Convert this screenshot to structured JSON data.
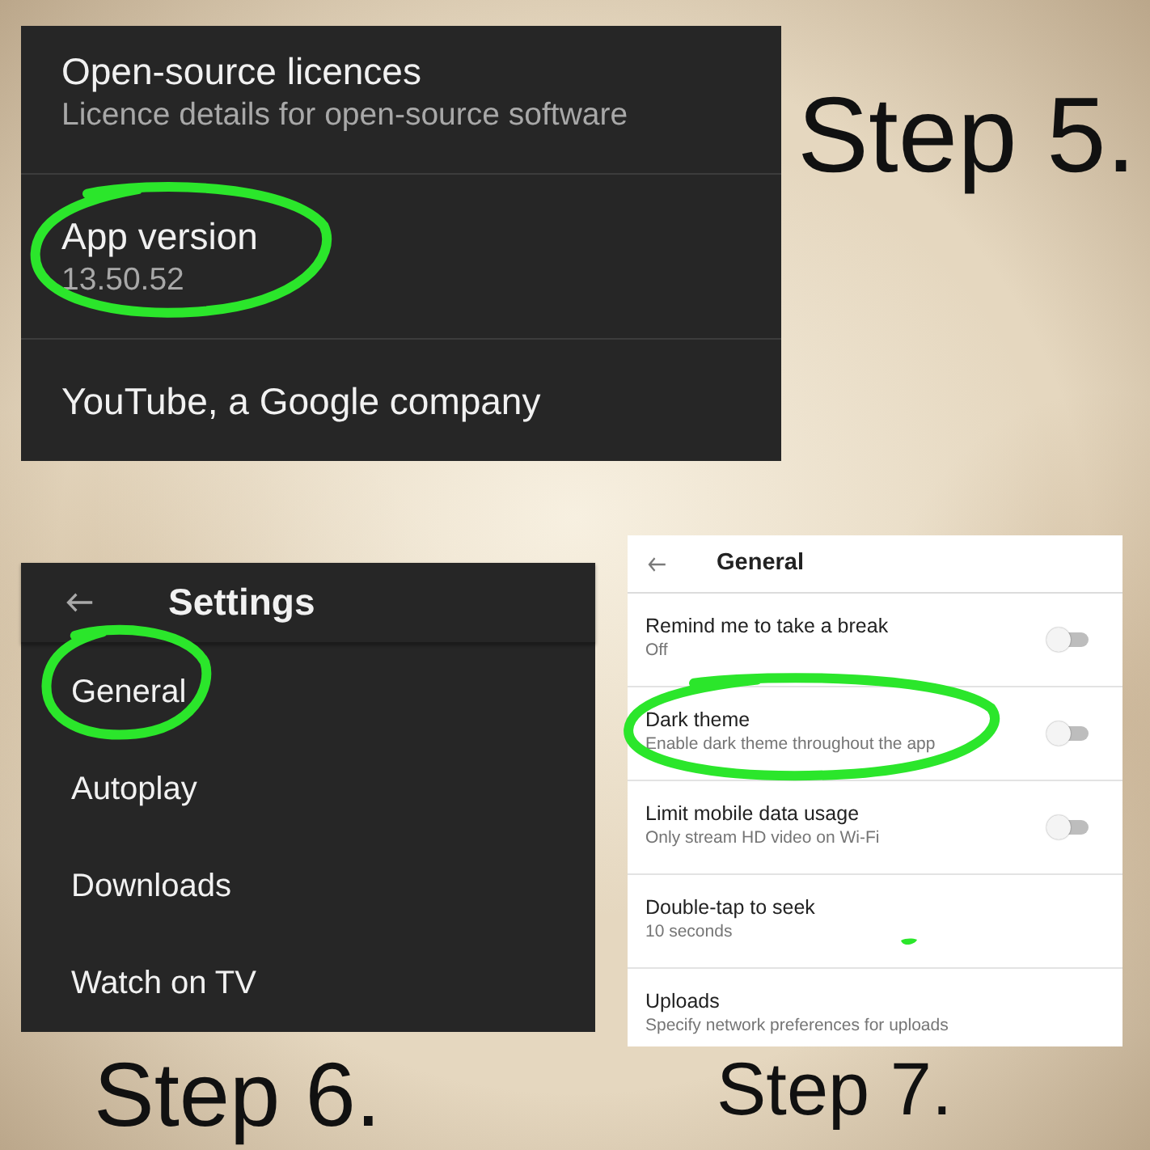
{
  "panels": [
    {
      "dark": true,
      "items": [
        {
          "title": "Open-source licences",
          "subtitle": "Licence details for open-source software",
          "circled": false
        },
        {
          "title": "App version",
          "subtitle": "13.50.52",
          "circled": true
        },
        {
          "title": "YouTube, a Google company",
          "circled": false
        }
      ],
      "step_label": "Step 5."
    },
    {
      "dark": true,
      "header": {
        "title": "Settings"
      },
      "items": [
        {
          "title": "General",
          "circled": true
        },
        {
          "title": "Autoplay",
          "circled": false
        },
        {
          "title": "Downloads",
          "circled": false
        },
        {
          "title": "Watch on TV",
          "circled": false
        }
      ],
      "step_label": "Step 6."
    },
    {
      "dark": false,
      "header": {
        "title": "General"
      },
      "items": [
        {
          "kind": "switch",
          "title": "Remind me to take a break",
          "subtitle": "Off",
          "on": false,
          "circled": false,
          "pen_mark": false
        },
        {
          "kind": "switch",
          "title": "Dark theme",
          "subtitle": "Enable dark theme throughout the app",
          "on": false,
          "circled": true,
          "pen_mark": false
        },
        {
          "kind": "switch",
          "title": "Limit mobile data usage",
          "subtitle": "Only stream HD video on Wi-Fi",
          "on": false,
          "circled": false,
          "pen_mark": false
        },
        {
          "kind": "plain",
          "title": "Double-tap to seek",
          "subtitle": "10 seconds",
          "circled": false,
          "pen_mark": true
        },
        {
          "kind": "plain",
          "title": "Uploads",
          "subtitle": "Specify network preferences for uploads",
          "circled": false,
          "pen_mark": false
        }
      ],
      "step_label": "Step 7."
    }
  ]
}
